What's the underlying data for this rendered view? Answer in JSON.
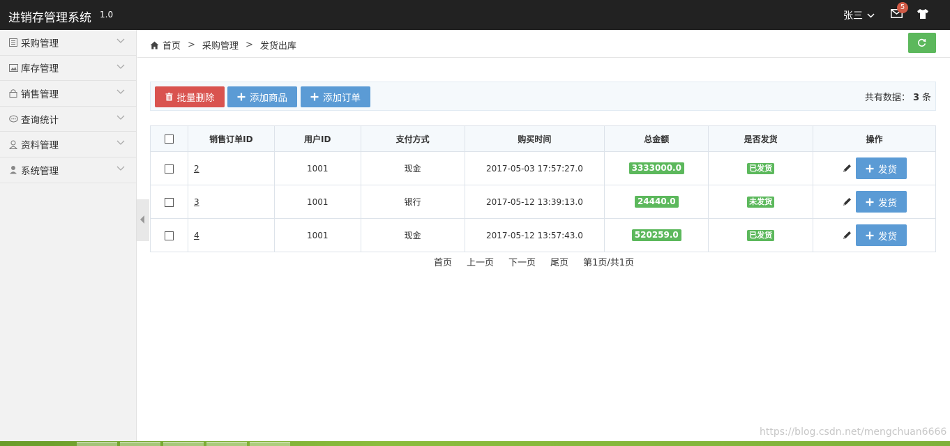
{
  "app": {
    "title": "进销存管理系统",
    "version": "1.0"
  },
  "user": {
    "name": "张三",
    "mail_count": "5"
  },
  "sidebar": {
    "items": [
      {
        "label": "采购管理",
        "icon": "list-icon"
      },
      {
        "label": "库存管理",
        "icon": "picture-icon"
      },
      {
        "label": "销售管理",
        "icon": "lock-icon"
      },
      {
        "label": "查询统计",
        "icon": "comment-icon"
      },
      {
        "label": "资料管理",
        "icon": "user-outline-icon"
      },
      {
        "label": "系统管理",
        "icon": "user-icon"
      }
    ]
  },
  "breadcrumb": {
    "home": "首页",
    "section": "采购管理",
    "current": "发货出库",
    "sep": ">"
  },
  "toolbar": {
    "batch_delete": "批量删除",
    "add_product": "添加商品",
    "add_order": "添加订单",
    "total_prefix": "共有数据：",
    "total_count": "3",
    "total_suffix": "条"
  },
  "table": {
    "headers": [
      "销售订单ID",
      "用户ID",
      "支付方式",
      "购买时间",
      "总金额",
      "是否发货",
      "操作"
    ],
    "rows": [
      {
        "id": "2",
        "user_id": "1001",
        "payment": "现金",
        "time": "2017-05-03 17:57:27.0",
        "amount": "3333000.0",
        "shipped": "已发货",
        "action": "发货"
      },
      {
        "id": "3",
        "user_id": "1001",
        "payment": "银行",
        "time": "2017-05-12 13:39:13.0",
        "amount": "24440.0",
        "shipped": "未发货",
        "action": "发货"
      },
      {
        "id": "4",
        "user_id": "1001",
        "payment": "现金",
        "time": "2017-05-12 13:57:43.0",
        "amount": "520259.0",
        "shipped": "已发货",
        "action": "发货"
      }
    ]
  },
  "pager": {
    "first": "首页",
    "prev": "上一页",
    "next": "下一页",
    "last": "尾页",
    "info": "第1页/共1页"
  },
  "watermark": "https://blog.csdn.net/mengchuan6666",
  "colors": {
    "topbar": "#222222",
    "success": "#5cb85c",
    "danger": "#d9534f",
    "primary": "#5b9bd5",
    "badge": "#d15b47"
  }
}
